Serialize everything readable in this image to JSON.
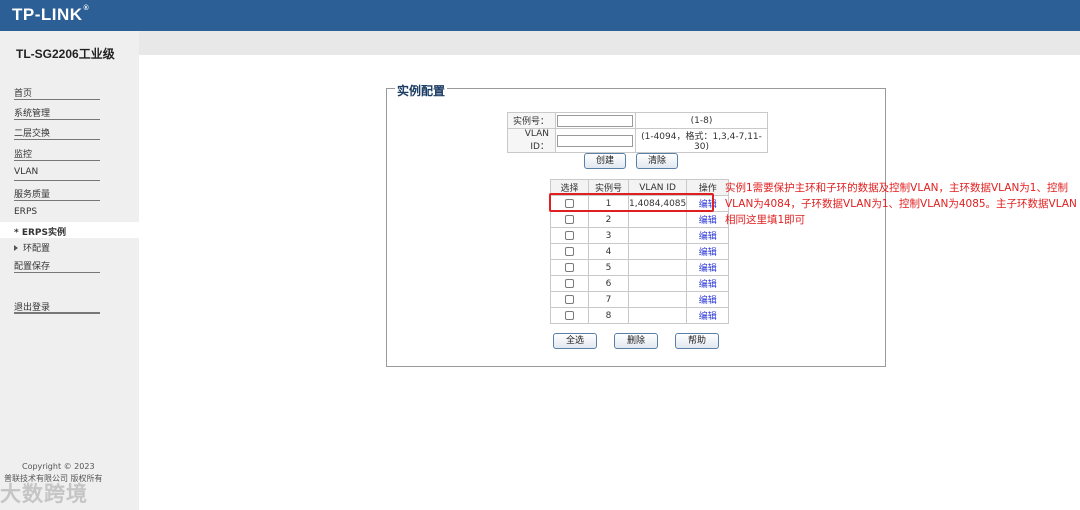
{
  "header": {
    "logo": "TP-LINK",
    "logo_mark": "®",
    "model": "TL-SG2206工业级"
  },
  "sidebar": {
    "items": [
      "首页",
      "系统管理",
      "二层交换",
      "监控",
      "VLAN",
      "服务质量"
    ],
    "erps": "ERPS",
    "active": "* ERPS实例",
    "sub": "环配置",
    "save": "配置保存",
    "logout": "退出登录"
  },
  "footer": {
    "copyright": "Copyright © 2023",
    "company": "普联技术有限公司 版权所有",
    "watermark": "大数跨境"
  },
  "panel": {
    "title": "实例配置",
    "instance_label": "实例号：",
    "instance_value": "",
    "instance_hint": "(1-8)",
    "vlan_label": "VLAN ID：",
    "vlan_value": "",
    "vlan_hint": "(1-4094，格式：1,3,4-7,11-30)",
    "create": "创建",
    "clear": "清除",
    "select_all": "全选",
    "delete": "删除",
    "help": "帮助"
  },
  "table": {
    "headers": [
      "选择",
      "实例号",
      "VLAN ID",
      "操作"
    ],
    "edit_label": "编辑",
    "rows": [
      {
        "id": "1",
        "vlan": "1,4084,4085"
      },
      {
        "id": "2",
        "vlan": ""
      },
      {
        "id": "3",
        "vlan": ""
      },
      {
        "id": "4",
        "vlan": ""
      },
      {
        "id": "5",
        "vlan": ""
      },
      {
        "id": "6",
        "vlan": ""
      },
      {
        "id": "7",
        "vlan": ""
      },
      {
        "id": "8",
        "vlan": ""
      }
    ]
  },
  "annotation": "实例1需要保护主环和子环的数据及控制VLAN，主环数据VLAN为1、控制VLAN为4084，子环数据VLAN为1、控制VLAN为4085。主子环数据VLAN相同这里填1即可",
  "colors": {
    "header": "#2b5f96",
    "annotation": "#e02020",
    "link": "#2a37d9"
  }
}
